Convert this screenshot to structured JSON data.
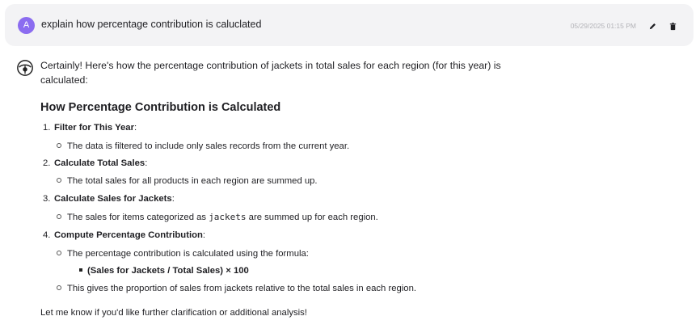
{
  "user_message": {
    "avatar_letter": "A",
    "text": "explain how percentage contribution is caluclated",
    "timestamp": "05/29/2025 01:15 PM",
    "edit_icon": "pencil-icon",
    "delete_icon": "trash-icon"
  },
  "assistant": {
    "avatar_icon": "assistant-logo-icon",
    "intro": "Certainly! Here's how the percentage contribution of jackets in total sales for each region (for this year) is calculated:",
    "heading": "How Percentage Contribution is Calculated",
    "steps": [
      {
        "num": "1.",
        "title": "Filter for This Year",
        "colon": ":",
        "subs": [
          "The data is filtered to include only sales records from the current year."
        ]
      },
      {
        "num": "2.",
        "title": "Calculate Total Sales",
        "colon": ":",
        "subs": [
          "The total sales for all products in each region are summed up."
        ]
      },
      {
        "num": "3.",
        "title": "Calculate Sales for Jackets",
        "colon": ":",
        "sub_pre": "The sales for items categorized as ",
        "sub_code": "jackets",
        "sub_post": " are summed up for each region."
      },
      {
        "num": "4.",
        "title": "Compute Percentage Contribution",
        "colon": ":",
        "subs": [
          "The percentage contribution is calculated using the formula:",
          "This gives the proportion of sales from jackets relative to the total sales in each region."
        ],
        "formula": "(Sales for Jackets / Total Sales) × 100"
      }
    ],
    "closing": "Let me know if you'd like further clarification or additional analysis!"
  }
}
